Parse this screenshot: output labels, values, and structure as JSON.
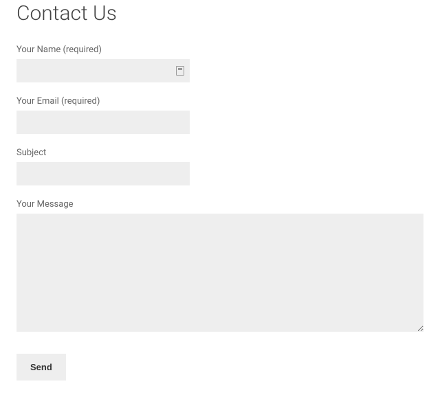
{
  "heading": "Contact Us",
  "form": {
    "name": {
      "label": "Your Name (required)",
      "value": ""
    },
    "email": {
      "label": "Your Email (required)",
      "value": ""
    },
    "subject": {
      "label": "Subject",
      "value": ""
    },
    "message": {
      "label": "Your Message",
      "value": ""
    },
    "submit_label": "Send"
  }
}
